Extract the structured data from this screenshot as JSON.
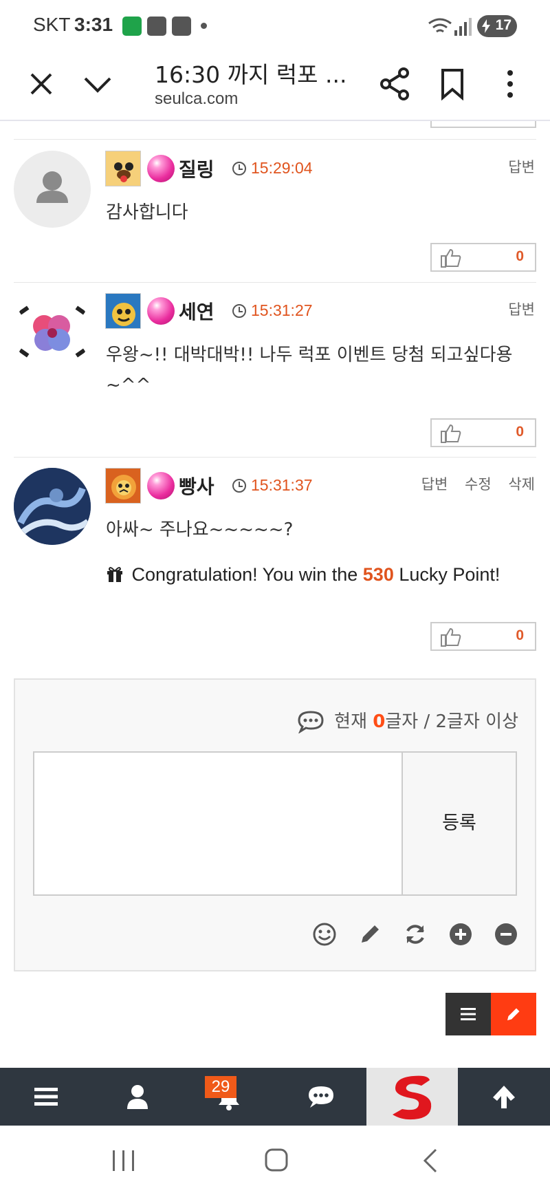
{
  "status_bar": {
    "carrier": "SKT",
    "time": "3:31",
    "battery": "17"
  },
  "browser": {
    "title": "16:30 까지 럭포 ...",
    "url": "seulca.com"
  },
  "comments": [
    {
      "nickname": "질링",
      "time": "15:29:04",
      "text": "감사합니다",
      "actions": [
        "답변"
      ],
      "likes": "0"
    },
    {
      "nickname": "세연",
      "time": "15:31:27",
      "text": "우왕~!!  대박대박!!  나두 럭포 이벤트 당첨 되고싶다용 ~^^",
      "actions": [
        "답변"
      ],
      "likes": "0"
    },
    {
      "nickname": "빵사",
      "time": "15:31:37",
      "text": "아싸~  주나요~~~~~?",
      "actions": [
        "답변",
        "수정",
        "삭제"
      ],
      "likes": "0",
      "lucky": {
        "prefix": "Congratulation! You win the",
        "points": "530",
        "suffix": "Lucky Point!"
      }
    }
  ],
  "write": {
    "counter_prefix": "현재",
    "counter_value": "0",
    "counter_suffix": "글자 / 2글자 이상",
    "submit_label": "등록"
  },
  "app_nav": {
    "badge_count": "29"
  }
}
